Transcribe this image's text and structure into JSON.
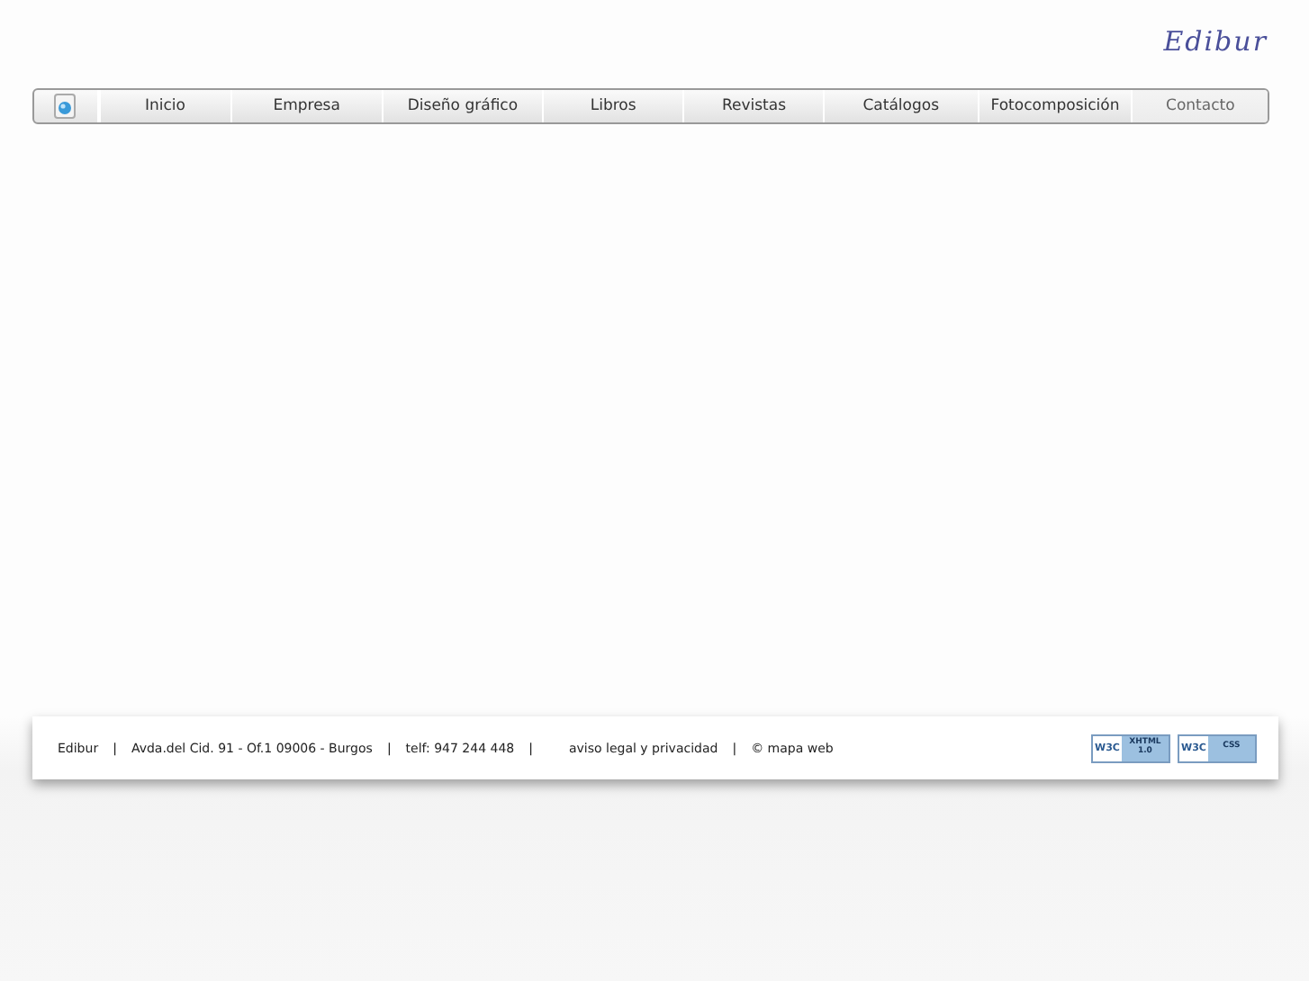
{
  "logo": "Edibur",
  "nav": [
    {
      "label": "Inicio",
      "selected": false
    },
    {
      "label": "Empresa",
      "selected": false
    },
    {
      "label": "Diseño gráfico",
      "selected": false
    },
    {
      "label": "Libros",
      "selected": false
    },
    {
      "label": "Revistas",
      "selected": false
    },
    {
      "label": "Catálogos",
      "selected": false
    },
    {
      "label": "Fotocomposición",
      "selected": false
    },
    {
      "label": "Contacto",
      "selected": true
    }
  ],
  "footer": {
    "items": [
      {
        "text": "Edibur",
        "kind": "text"
      },
      {
        "text": "|",
        "kind": "separator"
      },
      {
        "text": "Avda.del Cid. 91 - Of.1 09006 - Burgos",
        "kind": "text"
      },
      {
        "text": "|",
        "kind": "separator"
      },
      {
        "text": "telf: 947 244 448",
        "kind": "text"
      },
      {
        "text": "|",
        "kind": "separator"
      },
      {
        "text": "aviso legal y privacidad",
        "kind": "text"
      },
      {
        "text": "|",
        "kind": "separator"
      },
      {
        "text": "© mapa web",
        "kind": "text"
      }
    ],
    "badges": [
      {
        "w3c": "W3C",
        "label": "XHTML 1.0"
      },
      {
        "w3c": "W3C",
        "label": "CSS"
      }
    ]
  }
}
